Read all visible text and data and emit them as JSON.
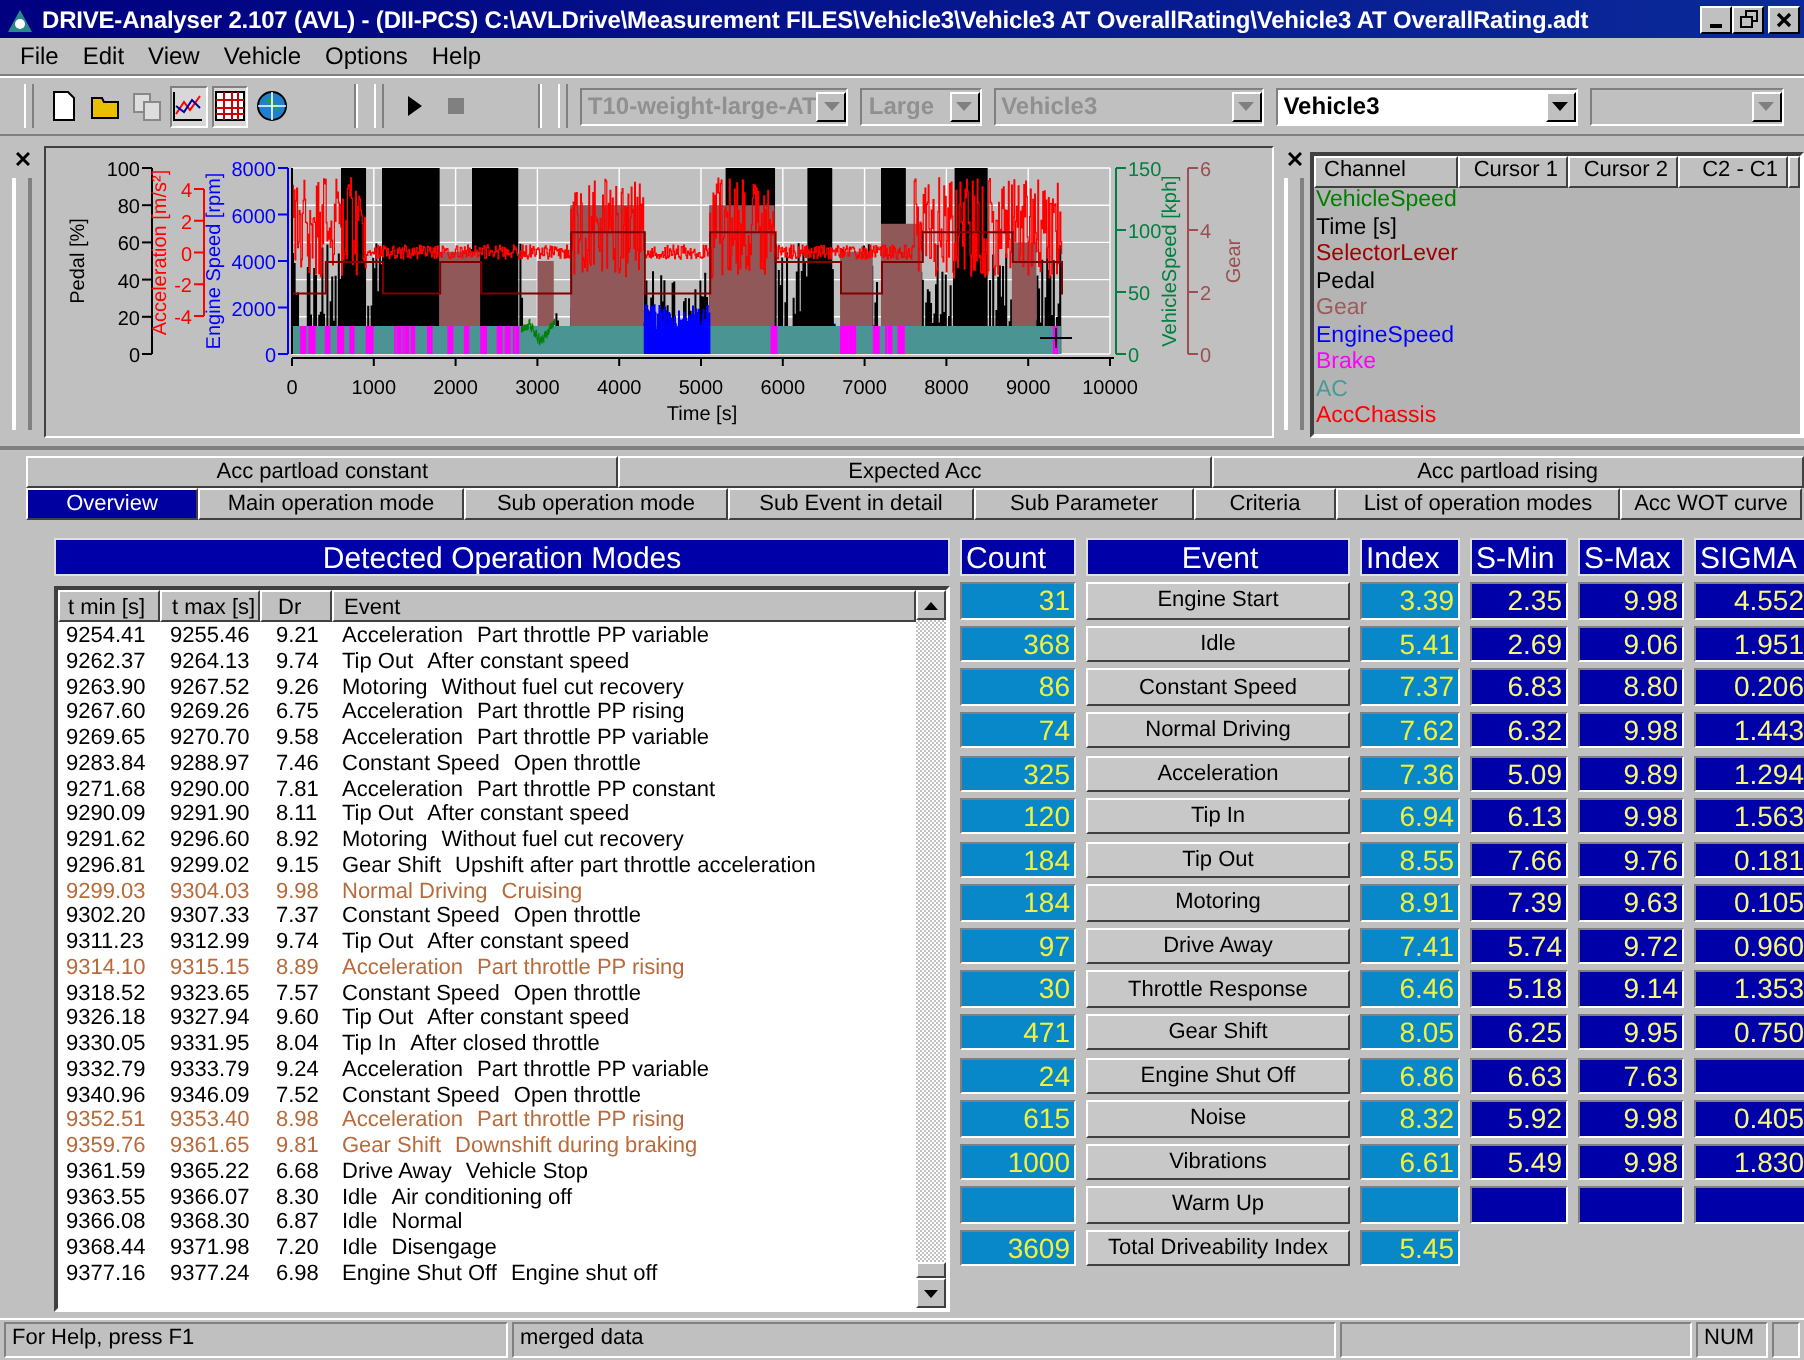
{
  "window": {
    "title": "DRIVE-Analyser 2.107 (AVL) - (DII-PCS) C:\\AVLDrive\\Measurement FILES\\Vehicle3\\Vehicle3 AT OverallRating\\Vehicle3 AT OverallRating.adt"
  },
  "menu": [
    "File",
    "Edit",
    "View",
    "Vehicle",
    "Options",
    "Help"
  ],
  "toolbar": {
    "combos": [
      {
        "value": "T10-weight-large-AT",
        "disabled": true
      },
      {
        "value": "Large",
        "disabled": true
      },
      {
        "value": "Vehicle3",
        "disabled": true
      },
      {
        "value": "Vehicle3",
        "disabled": false
      },
      {
        "disabled": true
      }
    ]
  },
  "chart": {
    "left_axes": [
      {
        "label": "Pedal [%]",
        "color": "#000000",
        "ticks": [
          "100",
          "80",
          "60",
          "40",
          "20",
          "0"
        ]
      },
      {
        "label": "Acceleration [m/s²]",
        "color": "#ff0000",
        "ticks": [
          "4",
          "2",
          "0",
          "-2",
          "-4"
        ]
      },
      {
        "label": "Engine Speed [rpm]",
        "color": "#0000ff",
        "ticks": [
          "8000",
          "6000",
          "4000",
          "2000",
          "0"
        ]
      }
    ],
    "right_axes": [
      {
        "label": "VehicleSpeed [kph]",
        "color": "#008040",
        "ticks": [
          "150",
          "100",
          "50",
          "0"
        ]
      },
      {
        "label": "Gear",
        "color": "#9a5050",
        "ticks": [
          "6",
          "4",
          "2",
          "0"
        ]
      }
    ],
    "x_axis": {
      "label": "Time [s]",
      "ticks": [
        "0",
        "1000",
        "2000",
        "3000",
        "4000",
        "5000",
        "6000",
        "7000",
        "8000",
        "9000",
        "10000"
      ]
    }
  },
  "channel_table": {
    "columns": [
      "Channel",
      "Cursor 1",
      "Cursor 2",
      "C2 - C1"
    ],
    "channels": [
      {
        "name": "VehicleSpeed",
        "color": "#008000"
      },
      {
        "name": "Time [s]",
        "color": "#000000"
      },
      {
        "name": "SelectorLever",
        "color": "#a00000"
      },
      {
        "name": "Pedal",
        "color": "#000000"
      },
      {
        "name": "Gear",
        "color": "#9a5c5c"
      },
      {
        "name": "EngineSpeed",
        "color": "#0000ff"
      },
      {
        "name": "Brake",
        "color": "#ff00ff"
      },
      {
        "name": "AC",
        "color": "#4a9a9a"
      },
      {
        "name": "AccChassis",
        "color": "#ff0000"
      }
    ]
  },
  "tabs": [
    [
      {
        "label": "Acc partload constant",
        "selected": false
      },
      {
        "label": "Expected Acc",
        "selected": false
      },
      {
        "label": "Acc partload rising",
        "selected": false
      }
    ],
    [
      {
        "label": "Overview",
        "selected": true
      },
      {
        "label": "Main operation mode",
        "selected": false
      },
      {
        "label": "Sub operation mode",
        "selected": false
      },
      {
        "label": "Sub Event in detail",
        "selected": false
      },
      {
        "label": "Sub Parameter",
        "selected": false
      },
      {
        "label": "Criteria",
        "selected": false
      },
      {
        "label": "List of operation modes",
        "selected": false
      },
      {
        "label": "Acc WOT curve",
        "selected": false
      }
    ]
  ],
  "modes_panel": {
    "title": "Detected Operation Modes",
    "columns": [
      "t min [s]",
      "t max [s]",
      "Dr",
      "Event"
    ],
    "rows": [
      {
        "t_min": "9254.41",
        "t_max": "9255.46",
        "dr": "9.21",
        "event": "Acceleration",
        "detail": "Part throttle PP variable",
        "highlighted": false
      },
      {
        "t_min": "9262.37",
        "t_max": "9264.13",
        "dr": "9.74",
        "event": "Tip Out",
        "detail": "After constant speed",
        "highlighted": false
      },
      {
        "t_min": "9263.90",
        "t_max": "9267.52",
        "dr": "9.26",
        "event": "Motoring",
        "detail": "Without fuel cut recovery",
        "highlighted": false
      },
      {
        "t_min": "9267.60",
        "t_max": "9269.26",
        "dr": "6.75",
        "event": "Acceleration",
        "detail": "Part throttle PP rising",
        "highlighted": false
      },
      {
        "t_min": "9269.65",
        "t_max": "9270.70",
        "dr": "9.58",
        "event": "Acceleration",
        "detail": "Part throttle PP variable",
        "highlighted": false
      },
      {
        "t_min": "9283.84",
        "t_max": "9288.97",
        "dr": "7.46",
        "event": "Constant Speed",
        "detail": "Open throttle",
        "highlighted": false
      },
      {
        "t_min": "9271.68",
        "t_max": "9290.00",
        "dr": "7.81",
        "event": "Acceleration",
        "detail": "Part throttle PP constant",
        "highlighted": false
      },
      {
        "t_min": "9290.09",
        "t_max": "9291.90",
        "dr": "8.11",
        "event": "Tip Out",
        "detail": "After constant speed",
        "highlighted": false
      },
      {
        "t_min": "9291.62",
        "t_max": "9296.60",
        "dr": "8.92",
        "event": "Motoring",
        "detail": "Without fuel cut recovery",
        "highlighted": false
      },
      {
        "t_min": "9296.81",
        "t_max": "9299.02",
        "dr": "9.15",
        "event": "Gear Shift",
        "detail": "Upshift after part throttle acceleration",
        "highlighted": false
      },
      {
        "t_min": "9299.03",
        "t_max": "9304.03",
        "dr": "9.98",
        "event": "Normal Driving",
        "detail": "Cruising",
        "highlighted": true
      },
      {
        "t_min": "9302.20",
        "t_max": "9307.33",
        "dr": "7.37",
        "event": "Constant Speed",
        "detail": "Open throttle",
        "highlighted": false
      },
      {
        "t_min": "9311.23",
        "t_max": "9312.99",
        "dr": "9.74",
        "event": "Tip Out",
        "detail": "After constant speed",
        "highlighted": false
      },
      {
        "t_min": "9314.10",
        "t_max": "9315.15",
        "dr": "8.89",
        "event": "Acceleration",
        "detail": "Part throttle PP rising",
        "highlighted": true
      },
      {
        "t_min": "9318.52",
        "t_max": "9323.65",
        "dr": "7.57",
        "event": "Constant Speed",
        "detail": "Open throttle",
        "highlighted": false
      },
      {
        "t_min": "9326.18",
        "t_max": "9327.94",
        "dr": "9.60",
        "event": "Tip Out",
        "detail": "After constant speed",
        "highlighted": false
      },
      {
        "t_min": "9330.05",
        "t_max": "9331.95",
        "dr": "8.04",
        "event": "Tip In",
        "detail": "After closed throttle",
        "highlighted": false
      },
      {
        "t_min": "9332.79",
        "t_max": "9333.79",
        "dr": "9.24",
        "event": "Acceleration",
        "detail": "Part throttle PP variable",
        "highlighted": false
      },
      {
        "t_min": "9340.96",
        "t_max": "9346.09",
        "dr": "7.52",
        "event": "Constant Speed",
        "detail": "Open throttle",
        "highlighted": false
      },
      {
        "t_min": "9352.51",
        "t_max": "9353.40",
        "dr": "8.98",
        "event": "Acceleration",
        "detail": "Part throttle PP rising",
        "highlighted": true
      },
      {
        "t_min": "9359.76",
        "t_max": "9361.65",
        "dr": "9.81",
        "event": "Gear Shift",
        "detail": "Downshift during braking",
        "highlighted": true
      },
      {
        "t_min": "9361.59",
        "t_max": "9365.22",
        "dr": "6.68",
        "event": "Drive Away",
        "detail": "Vehicle Stop",
        "highlighted": false
      },
      {
        "t_min": "9363.55",
        "t_max": "9366.07",
        "dr": "8.30",
        "event": "Idle",
        "detail": "Air conditioning off",
        "highlighted": false
      },
      {
        "t_min": "9366.08",
        "t_max": "9368.30",
        "dr": "6.87",
        "event": "Idle",
        "detail": "Normal",
        "highlighted": false
      },
      {
        "t_min": "9368.44",
        "t_max": "9371.98",
        "dr": "7.20",
        "event": "Idle",
        "detail": "Disengage",
        "highlighted": false
      },
      {
        "t_min": "9377.16",
        "t_max": "9377.24",
        "dr": "6.98",
        "event": "Engine Shut Off",
        "detail": "Engine shut off",
        "highlighted": false
      }
    ]
  },
  "summary": {
    "columns": [
      "Count",
      "Event",
      "Index",
      "S-Min",
      "S-Max",
      "SIGMA"
    ],
    "rows": [
      {
        "kind": "event",
        "count": "31",
        "event": "Engine Start",
        "index": "3.39",
        "s_min": "2.35",
        "s_max": "9.98",
        "sigma": "4.552"
      },
      {
        "kind": "event",
        "count": "368",
        "event": "Idle",
        "index": "5.41",
        "s_min": "2.69",
        "s_max": "9.06",
        "sigma": "1.951"
      },
      {
        "kind": "event",
        "count": "86",
        "event": "Constant Speed",
        "index": "7.37",
        "s_min": "6.83",
        "s_max": "8.80",
        "sigma": "0.206"
      },
      {
        "kind": "event",
        "count": "74",
        "event": "Normal Driving",
        "index": "7.62",
        "s_min": "6.32",
        "s_max": "9.98",
        "sigma": "1.443"
      },
      {
        "kind": "event",
        "count": "325",
        "event": "Acceleration",
        "index": "7.36",
        "s_min": "5.09",
        "s_max": "9.89",
        "sigma": "1.294"
      },
      {
        "kind": "event",
        "count": "120",
        "event": "Tip In",
        "index": "6.94",
        "s_min": "6.13",
        "s_max": "9.98",
        "sigma": "1.563"
      },
      {
        "kind": "event",
        "count": "184",
        "event": "Tip Out",
        "index": "8.55",
        "s_min": "7.66",
        "s_max": "9.76",
        "sigma": "0.181"
      },
      {
        "kind": "event",
        "count": "184",
        "event": "Motoring",
        "index": "8.91",
        "s_min": "7.39",
        "s_max": "9.63",
        "sigma": "0.105"
      },
      {
        "kind": "event",
        "count": "97",
        "event": "Drive Away",
        "index": "7.41",
        "s_min": "5.74",
        "s_max": "9.72",
        "sigma": "0.960"
      },
      {
        "kind": "event",
        "count": "30",
        "event": "Throttle Response",
        "index": "6.46",
        "s_min": "5.18",
        "s_max": "9.14",
        "sigma": "1.353"
      },
      {
        "kind": "event",
        "count": "471",
        "event": "Gear Shift",
        "index": "8.05",
        "s_min": "6.25",
        "s_max": "9.95",
        "sigma": "0.750"
      },
      {
        "kind": "event",
        "count": "24",
        "event": "Engine Shut Off",
        "index": "6.86",
        "s_min": "6.63",
        "s_max": "7.63"
      },
      {
        "kind": "event",
        "count": "615",
        "event": "Noise",
        "index": "8.32",
        "s_min": "5.92",
        "s_max": "9.98",
        "sigma": "0.405"
      },
      {
        "kind": "event",
        "count": "1000",
        "event": "Vibrations",
        "index": "6.61",
        "s_min": "5.49",
        "s_max": "9.98",
        "sigma": "1.830"
      },
      {
        "kind": "event",
        "event": "Warm Up"
      },
      {
        "kind": "total",
        "count": "3609",
        "event": "Total Driveability Index",
        "index": "5.45"
      }
    ]
  },
  "status_bar": [
    "For Help, press F1",
    "merged data",
    "NUM"
  ]
}
